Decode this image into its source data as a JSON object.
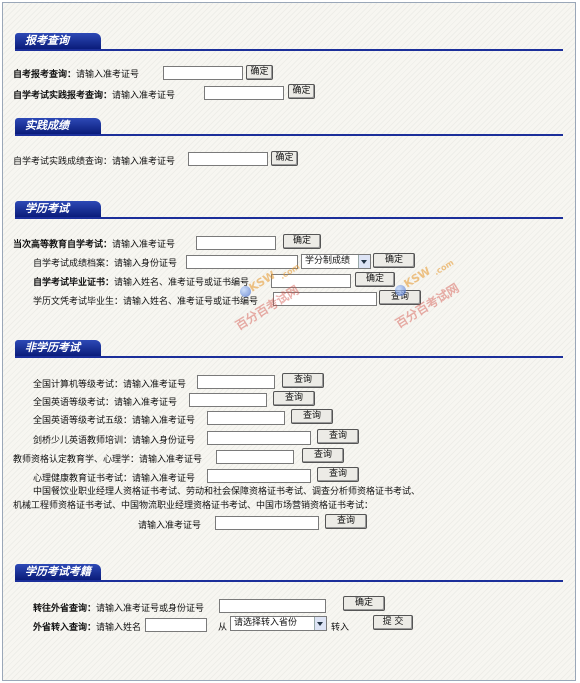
{
  "sections": {
    "s1": "报考查询",
    "s2": "实践成绩",
    "s3": "学历考试",
    "s4": "非学历考试",
    "s5": "学历考试考籍"
  },
  "rows": {
    "zkbk_label": "自考报考查询：",
    "zkbk_hint": "请输入准考证号",
    "zxsj_label": "自学考试实践报考查询：",
    "zxsj_hint": "请输入准考证号",
    "sjcj_text": "自学考试实践成绩查询：请输入准考证号",
    "dcgd_label": "当次高等教育自学考试：",
    "dcgd_hint": "请输入准考证号",
    "cjda_text": "自学考试成绩档案：请输入身份证号",
    "byzs_label": "自学考试毕业证书：",
    "byzs_hint": "请输入姓名、准考证号或证书编号",
    "xlwp_text": "学历文凭考试毕业生：请输入姓名、准考证号或证书编号",
    "jsj_text": "全国计算机等级考试：请输入准考证号",
    "yydj_text": "全国英语等级考试：请输入准考证号",
    "yywj_text": "全国英语等级考试五级：请输入准考证号",
    "jq_text": "剑桥少儿英语教师培训：请输入身份证号",
    "jszg_text": "教师资格认定教育学、心理学：请输入准考证号",
    "xljk_text": "心理健康教育证书考试：请输入准考证号",
    "zyzg_line1": "中国餐饮业职业经理人资格证书考试、劳动和社会保障资格证书考试、调查分析师资格证书考试、",
    "zyzg_line2": "机械工程师资格证书考试、中国物流职业经理资格证书考试、中国市场营销资格证书考试：",
    "zyzg_hint": "请输入准考证号",
    "zwsf_label": "转往外省查询：",
    "zwsf_hint": "请输入准考证号或身份证号",
    "wszr_label": "外省转入查询：",
    "wszr_hint": "请输入姓名",
    "wszr_from": "从",
    "wszr_to": "转入"
  },
  "buttons": {
    "confirm": "确定",
    "query": "查询",
    "submit": "提 交"
  },
  "selects": {
    "score_mode": "学分制成绩",
    "province": "请选择转入省份"
  },
  "watermark": {
    "brand": "KSW",
    "domain": ".com",
    "text": "百分百考试网"
  }
}
